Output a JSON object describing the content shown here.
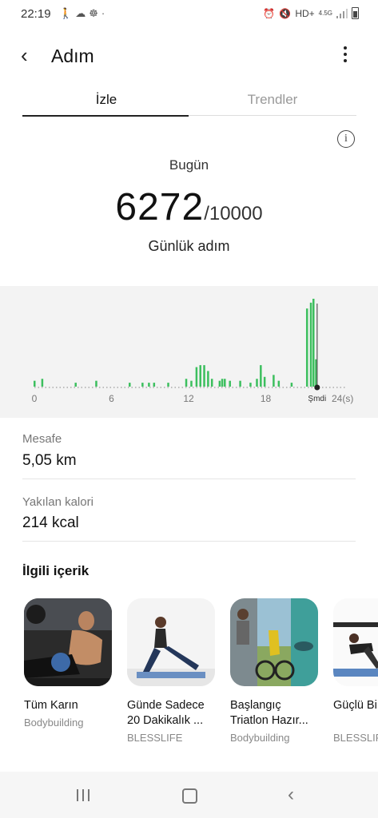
{
  "status_bar": {
    "time": "22:19",
    "left_icons": [
      "walk-icon",
      "cloud-icon",
      "meditation-icon",
      "dot-icon"
    ],
    "network_label": "HD+",
    "network_type": "4.5G"
  },
  "header": {
    "title": "Adım"
  },
  "tabs": [
    {
      "label": "İzle",
      "active": true
    },
    {
      "label": "Trendler",
      "active": false
    }
  ],
  "summary": {
    "period": "Bugün",
    "steps": "6272",
    "goal": "/10000",
    "caption": "Günlük adım"
  },
  "chart_data": {
    "type": "bar",
    "x_ticks": [
      "0",
      "6",
      "12",
      "18",
      "24(s)"
    ],
    "now_label": "Şmdi",
    "now_hour": 22,
    "xlim": [
      0,
      24
    ],
    "color": "#3cbf5e",
    "bars": [
      [
        0.0,
        3
      ],
      [
        0.6,
        4
      ],
      [
        3.2,
        2
      ],
      [
        4.8,
        3
      ],
      [
        7.4,
        2
      ],
      [
        8.4,
        2
      ],
      [
        8.9,
        2
      ],
      [
        9.3,
        2
      ],
      [
        10.4,
        2
      ],
      [
        11.8,
        4
      ],
      [
        12.2,
        3
      ],
      [
        12.6,
        10
      ],
      [
        12.9,
        11
      ],
      [
        13.2,
        11
      ],
      [
        13.5,
        8
      ],
      [
        13.8,
        4
      ],
      [
        14.4,
        3
      ],
      [
        14.6,
        4
      ],
      [
        14.8,
        4
      ],
      [
        15.2,
        3
      ],
      [
        16.0,
        3
      ],
      [
        16.8,
        2
      ],
      [
        17.3,
        4
      ],
      [
        17.6,
        11
      ],
      [
        17.9,
        5
      ],
      [
        18.6,
        6
      ],
      [
        19.0,
        3
      ],
      [
        20.0,
        2
      ],
      [
        21.2,
        40
      ],
      [
        21.5,
        43
      ],
      [
        21.7,
        45
      ],
      [
        21.9,
        14
      ]
    ],
    "grid": false
  },
  "metrics": [
    {
      "label": "Mesafe",
      "value": "5,05 km"
    },
    {
      "label": "Yakılan kalori",
      "value": "214 kcal"
    }
  ],
  "related": {
    "heading": "İlgili içerik",
    "cards": [
      {
        "title": "Tüm Karın",
        "subtitle": "Bodybuilding"
      },
      {
        "title": "Günde Sadece 20 Dakikalık ...",
        "subtitle": "BLESSLIFE"
      },
      {
        "title": "Başlangıç Triatlon Hazır...",
        "subtitle": "Bodybuilding"
      },
      {
        "title": "Güçlü Bi Vücuda",
        "subtitle": "BLESSLIFE"
      }
    ]
  }
}
